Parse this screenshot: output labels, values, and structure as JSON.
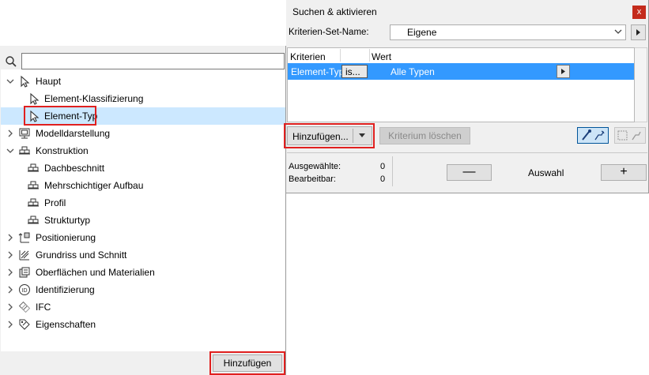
{
  "left_panel": {
    "search_placeholder": "",
    "tree": [
      {
        "label": "Haupt",
        "icon": "pointer-arrow-icon",
        "expanded": true
      },
      {
        "label": "Element-Klassifizierung",
        "icon": "pointer-arrow-icon"
      },
      {
        "label": "Element-Typ",
        "icon": "pointer-arrow-icon",
        "selected": true
      },
      {
        "label": "Modelldarstellung",
        "icon": "monitor-icon",
        "expanded": false
      },
      {
        "label": "Konstruktion",
        "icon": "bricks-icon",
        "expanded": true
      },
      {
        "label": "Dachbeschnitt",
        "icon": "bricks-icon"
      },
      {
        "label": "Mehrschichtiger Aufbau",
        "icon": "bricks-icon"
      },
      {
        "label": "Profil",
        "icon": "bricks-icon"
      },
      {
        "label": "Strukturtyp",
        "icon": "bricks-icon"
      },
      {
        "label": "Positionierung",
        "icon": "positioning-icon",
        "expanded": false
      },
      {
        "label": "Grundriss und Schnitt",
        "icon": "floorplan-icon",
        "expanded": false
      },
      {
        "label": "Oberflächen und Materialien",
        "icon": "materials-icon",
        "expanded": false
      },
      {
        "label": "Identifizierung",
        "icon": "id-icon",
        "expanded": false
      },
      {
        "label": "IFC",
        "icon": "ifc-icon",
        "expanded": false
      },
      {
        "label": "Eigenschaften",
        "icon": "tag-icon",
        "expanded": false
      }
    ],
    "add_button": "Hinzufügen"
  },
  "dialog": {
    "title": "Suchen & aktivieren",
    "close": "x",
    "criteria_set_label": "Kriterien-Set-Name:",
    "criteria_set_value": "Eigene",
    "columns": [
      "Kriterien",
      "Wert"
    ],
    "rows": [
      {
        "criterion": "Element-Typ",
        "operator": "is...",
        "value": "Alle Typen"
      }
    ],
    "add_button": "Hinzufügen...",
    "delete_button": "Kriterium löschen",
    "selected_label": "Ausgewählte:",
    "selected_count": "0",
    "editable_label": "Bearbeitbar:",
    "editable_count": "0",
    "minus": "—",
    "selection_label": "Auswahl",
    "plus": "+"
  },
  "colors": {
    "selection_blue": "#3399ff",
    "tree_selected": "#cce8ff",
    "highlight_red": "#e0201f",
    "close_red": "#c42b1c"
  }
}
